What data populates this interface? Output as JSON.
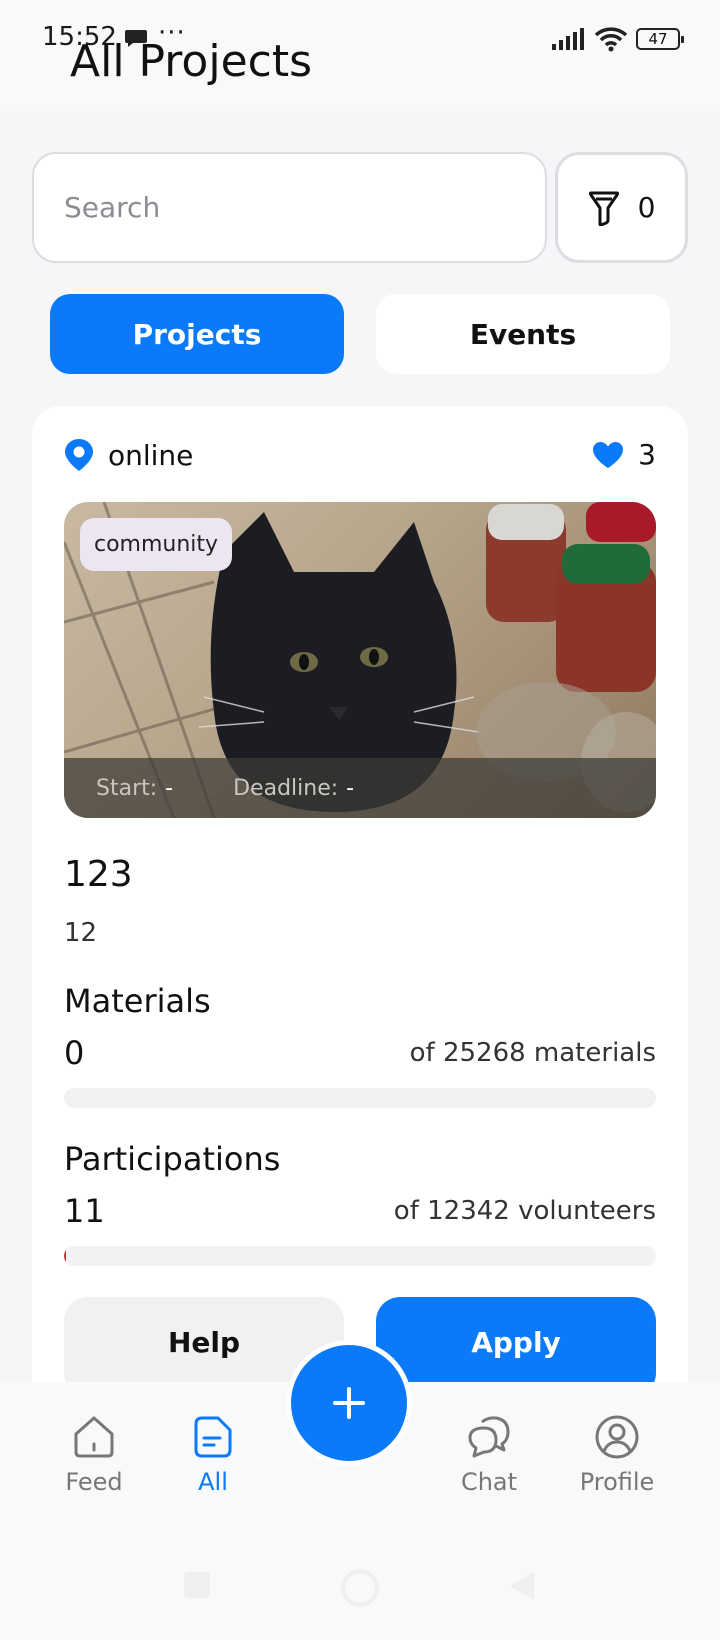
{
  "status_bar": {
    "time": "15:52",
    "dots": "···",
    "battery": "47"
  },
  "header": {
    "title": "All Projects"
  },
  "search": {
    "placeholder": "Search"
  },
  "filter": {
    "count": "0"
  },
  "segments": {
    "projects": "Projects",
    "events": "Events"
  },
  "project": {
    "location": "online",
    "likes": "3",
    "tag": "community",
    "start_label": "Start:",
    "start_value": "-",
    "deadline_label": "Deadline:",
    "deadline_value": "-",
    "title": "123",
    "subtitle": "12",
    "materials": {
      "label": "Materials",
      "value": "0",
      "of_text": "of 25268 materials",
      "progress": 0
    },
    "participations": {
      "label": "Participations",
      "value": "11",
      "of_text": "of 12342 volunteers",
      "progress": 0.0009
    },
    "help_label": "Help",
    "apply_label": "Apply"
  },
  "nav": {
    "feed": "Feed",
    "all": "All",
    "chat": "Chat",
    "profile": "Profile"
  },
  "colors": {
    "accent": "#0a7af9",
    "progress": "#c0392b"
  }
}
